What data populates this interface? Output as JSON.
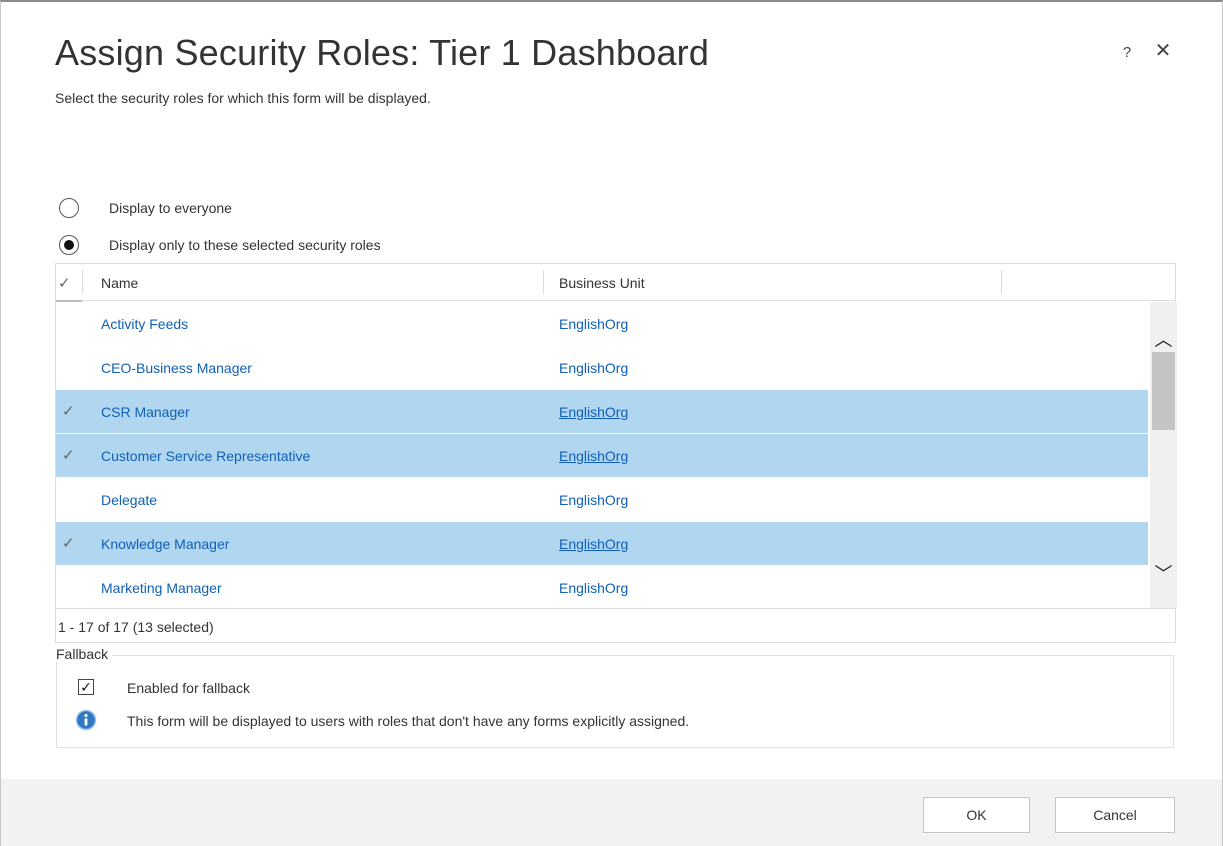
{
  "dialog": {
    "title": "Assign Security Roles: Tier 1 Dashboard",
    "subtitle": "Select the security roles for which this form will be displayed.",
    "help_glyph": "?",
    "close_glyph": "✕"
  },
  "display_options": [
    {
      "label": "Display to everyone",
      "selected": false
    },
    {
      "label": "Display only to these selected security roles",
      "selected": true
    }
  ],
  "grid": {
    "check_glyph": "✓",
    "columns": [
      "Name",
      "Business Unit"
    ],
    "rows": [
      {
        "name": "Activity Feeds",
        "business_unit": "EnglishOrg",
        "selected": false
      },
      {
        "name": "CEO-Business Manager",
        "business_unit": "EnglishOrg",
        "selected": false
      },
      {
        "name": "CSR Manager",
        "business_unit": "EnglishOrg",
        "selected": true
      },
      {
        "name": "Customer Service Representative",
        "business_unit": "EnglishOrg",
        "selected": true
      },
      {
        "name": "Delegate",
        "business_unit": "EnglishOrg",
        "selected": false
      },
      {
        "name": "Knowledge Manager",
        "business_unit": "EnglishOrg",
        "selected": true
      },
      {
        "name": "Marketing Manager",
        "business_unit": "EnglishOrg",
        "selected": false
      }
    ],
    "footer": "1 - 17 of 17 (13 selected)",
    "scroll_up_glyph": "︿",
    "scroll_down_glyph": "﹀"
  },
  "fallback": {
    "legend": "Fallback",
    "checkbox_label": "Enabled for fallback",
    "checkbox_checked": true,
    "checkbox_glyph": "✓",
    "info_text": "This form will be displayed to users with roles that don't have any forms explicitly assigned."
  },
  "buttons": {
    "ok": "OK",
    "cancel": "Cancel"
  },
  "colors": {
    "selected_row": "#b1d6f0",
    "link": "#1160b7"
  }
}
